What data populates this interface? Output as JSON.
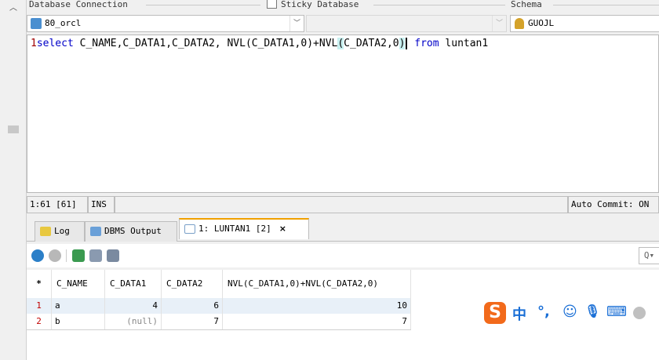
{
  "connection": {
    "db_label": "Database Connection",
    "sticky_label": "Sticky Database",
    "schema_label": "Schema",
    "db_value": "80_orcl",
    "schema_value": "GUOJL"
  },
  "editor": {
    "line_number": "1",
    "sql": {
      "kw_select": "select",
      "part1": " C_NAME,C_DATA1,C_DATA2, NVL(C_DATA1,0)+NVL",
      "paren_open": "(",
      "part2": "C_DATA2,0",
      "paren_close": ")",
      "space": " ",
      "kw_from": "from",
      "part3": " luntan1"
    }
  },
  "status_bar": {
    "position": "1:61 [61]",
    "mode": "INS",
    "autocommit": "Auto Commit: ON"
  },
  "tabs": [
    {
      "label": "Log"
    },
    {
      "label": "DBMS Output"
    },
    {
      "label": "1: LUNTAN1 [2]",
      "close": "×"
    }
  ],
  "grid": {
    "marker": "*",
    "columns": [
      "C_NAME",
      "C_DATA1",
      "C_DATA2",
      "NVL(C_DATA1,0)+NVL(C_DATA2,0)"
    ],
    "rows": [
      {
        "num": "1",
        "cells": [
          "a",
          "4",
          "6",
          "10"
        ]
      },
      {
        "num": "2",
        "cells": [
          "b",
          "(null)",
          "7",
          "7"
        ]
      }
    ]
  },
  "search": {
    "label": "Q▾"
  },
  "ime": {
    "logo": "S",
    "lang": "中",
    "punct": "°,",
    "emoji": "☺",
    "mic": "🎙",
    "keyboard": "⌨"
  }
}
